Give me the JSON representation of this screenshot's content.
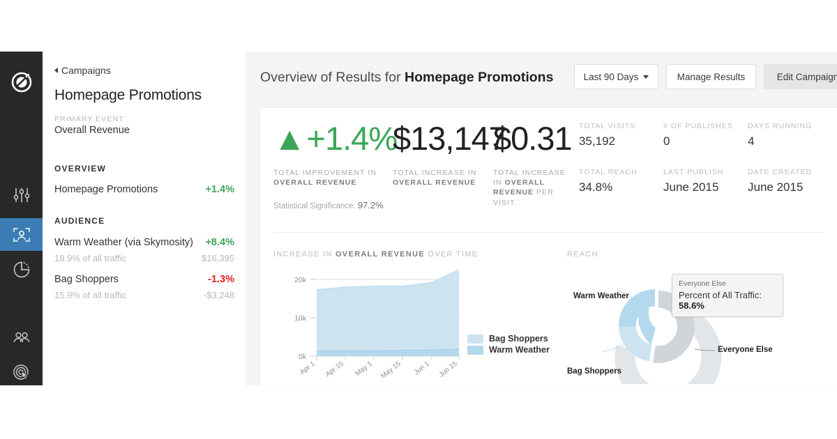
{
  "rail": {
    "logo_icon": "optimizely-logo-icon",
    "items": [
      {
        "icon": "sliders-icon",
        "name": "experiments",
        "selected": false
      },
      {
        "icon": "audience-frame-icon",
        "name": "audiences",
        "selected": true
      },
      {
        "icon": "pie-chart-icon",
        "name": "results",
        "selected": false
      },
      {
        "icon": "people-icon",
        "name": "collaborators",
        "selected": false
      },
      {
        "icon": "target-click-icon",
        "name": "targeting",
        "selected": false
      }
    ]
  },
  "panel": {
    "breadcrumb": "Campaigns",
    "title": "Homepage Promotions",
    "primary_event_label": "PRIMARY EVENT",
    "primary_event_value": "Overall Revenue",
    "overview_heading": "OVERVIEW",
    "overview_rows": [
      {
        "label": "Homepage Promotions",
        "value": "+1.4%",
        "tone": "pos"
      }
    ],
    "audience_heading": "AUDIENCE",
    "audience_rows": [
      {
        "label": "Warm Weather (via Skymosity)",
        "value": "+8.4%",
        "tone": "pos",
        "sub_label": "18.9% of all traffic",
        "sub_value": "$16,395"
      },
      {
        "label": "Bag Shoppers",
        "value": "-1.3%",
        "tone": "neg",
        "sub_label": "15.9% of all traffic",
        "sub_value": "-$3,248"
      }
    ]
  },
  "header": {
    "title_prefix": "Overview of Results for ",
    "title_bold": "Homepage Promotions",
    "date_button": "Last 90 Days",
    "manage_button": "Manage Results",
    "edit_button": "Edit Campaign"
  },
  "hero": {
    "improvement": {
      "arrow": "▲",
      "value": "+1.4%",
      "caption_pre": "TOTAL IMPROVEMENT IN ",
      "caption_bold": "OVERALL REVENUE"
    },
    "total_increase": {
      "value": "$13,147",
      "caption_pre": "TOTAL INCREASE IN ",
      "caption_bold": "OVERALL REVENUE"
    },
    "per_visit": {
      "value": "$0.31",
      "caption_pre": "TOTAL INCREASE IN ",
      "caption_bold": "OVERALL REVENUE",
      "caption_post": " PER VISIT"
    },
    "significance_label": "Statistical Significance: ",
    "significance_value": "97.2%"
  },
  "kpis": [
    {
      "label": "TOTAL VISITS",
      "value": "35,192"
    },
    {
      "label": "# OF PUBLISHES",
      "value": "0"
    },
    {
      "label": "DAYS RUNNING",
      "value": "4"
    },
    {
      "label": "TOTAL REACH",
      "value": "34.8%"
    },
    {
      "label": "LAST PUBLISH",
      "value": "June 2015"
    },
    {
      "label": "DATE CREATED",
      "value": "June 2015"
    }
  ],
  "area_section": {
    "title_pre": "INCREASE IN ",
    "title_bold": "OVERALL REVENUE",
    "title_post": " OVER TIME"
  },
  "reach_section": {
    "title": "REACH",
    "labels": {
      "warm_weather": "Warm Weather",
      "bag_shoppers": "Bag Shoppers",
      "everyone_else": "Everyone Else"
    },
    "tooltip": {
      "name": "Everyone Else",
      "metric_label": "Percent of All Traffic: ",
      "metric_value": "58.6%"
    }
  },
  "colors": {
    "accent_blue": "#3b7cb4",
    "positive_green": "#3aa757",
    "negative_red": "#e02020",
    "bag_shoppers": "#cde4f0",
    "warm_weather": "#b3d9ed",
    "everyone_else": "#cfd5d8",
    "rail_bg": "#282828",
    "page_bg": "#f4f4f4"
  },
  "chart_data": [
    {
      "type": "area",
      "title": "INCREASE IN OVERALL REVENUE OVER TIME",
      "xlabel": "",
      "ylabel": "",
      "stacked": true,
      "grid": true,
      "ylim": [
        0,
        25000
      ],
      "yticks": [
        0,
        10000,
        20000
      ],
      "ytick_labels": [
        "0k",
        "10k",
        "20k"
      ],
      "x": [
        "Apr 1",
        "Apr 15",
        "May 1",
        "May 15",
        "Jun 1",
        "Jun 15"
      ],
      "xtick_labels": [
        "Apr 1",
        "Apr 15",
        "May 1",
        "May 15",
        "Jun 1",
        "Jun 15"
      ],
      "legend": [
        "Bag Shoppers",
        "Warm Weather"
      ],
      "legend_position": "right",
      "series": [
        {
          "name": "Warm Weather",
          "color": "#b3d9ed",
          "values": [
            1350,
            1400,
            1450,
            1500,
            1600,
            1850
          ]
        },
        {
          "name": "Bag Shoppers",
          "color": "#cde4f0",
          "values": [
            16000,
            16600,
            16800,
            16750,
            17600,
            20700
          ]
        }
      ],
      "totals": [
        17350,
        18000,
        18250,
        18250,
        19200,
        22550
      ]
    },
    {
      "type": "pie",
      "variant": "donut",
      "title": "REACH",
      "labels": [
        "Warm Weather",
        "Bag Shoppers",
        "Everyone Else"
      ],
      "values": [
        18.9,
        15.9,
        58.6
      ],
      "colors": [
        "#b3d9ed",
        "#cde4f0",
        "#cfd5d8"
      ],
      "units": "percent of all traffic",
      "highlighted_slice": "Everyone Else",
      "tooltip_value": "58.6%"
    }
  ]
}
